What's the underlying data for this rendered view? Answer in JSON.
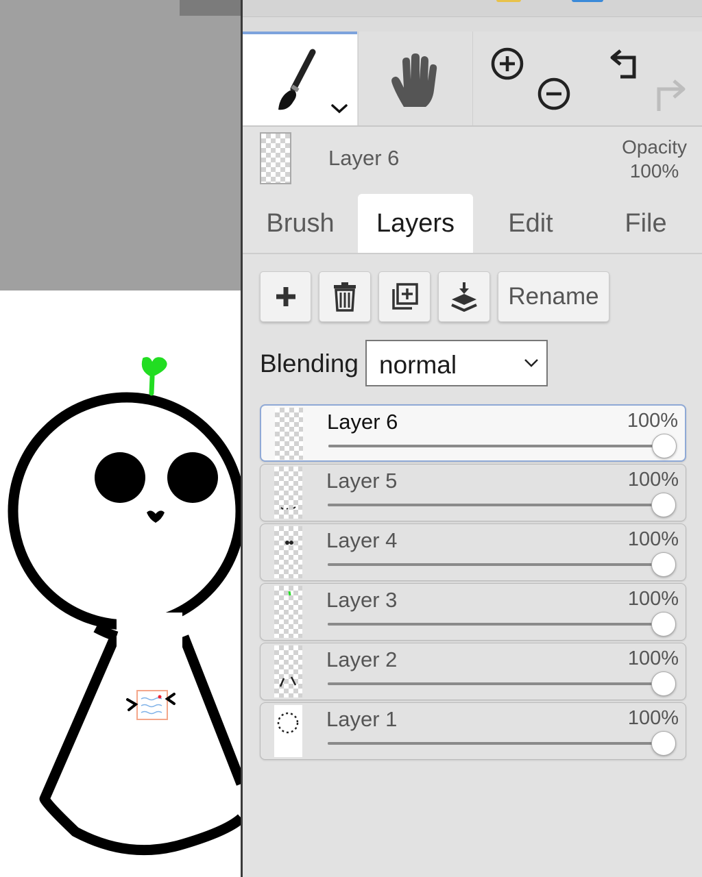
{
  "colors": {
    "accent": "#7da3dc",
    "panel_bg": "#dcdcdc",
    "sprout_green": "#22dd22"
  },
  "toolbar": {
    "brush_icon": "paintbrush-icon",
    "hand_icon": "hand-icon",
    "zoom_in_icon": "zoom-in-icon",
    "zoom_out_icon": "zoom-out-icon",
    "undo_icon": "undo-icon",
    "redo_icon": "redo-icon"
  },
  "current_layer": {
    "name": "Layer 6",
    "opacity_label": "Opacity",
    "opacity_value": "100%"
  },
  "tabs": [
    {
      "label": "Brush",
      "active": false
    },
    {
      "label": "Layers",
      "active": true
    },
    {
      "label": "Edit",
      "active": false
    },
    {
      "label": "File",
      "active": false
    }
  ],
  "layer_actions": {
    "add_icon": "plus-icon",
    "delete_icon": "trash-icon",
    "duplicate_icon": "duplicate-icon",
    "merge_down_icon": "merge-down-icon",
    "rename_label": "Rename"
  },
  "blending": {
    "label": "Blending",
    "value": "normal"
  },
  "layers": [
    {
      "name": "Layer 6",
      "opacity": "100%",
      "opacity_level": 1.0,
      "selected": true
    },
    {
      "name": "Layer 5",
      "opacity": "100%",
      "opacity_level": 1.0,
      "selected": false
    },
    {
      "name": "Layer 4",
      "opacity": "100%",
      "opacity_level": 1.0,
      "selected": false
    },
    {
      "name": "Layer 3",
      "opacity": "100%",
      "opacity_level": 1.0,
      "selected": false
    },
    {
      "name": "Layer 2",
      "opacity": "100%",
      "opacity_level": 1.0,
      "selected": false
    },
    {
      "name": "Layer 1",
      "opacity": "100%",
      "opacity_level": 1.0,
      "selected": false
    }
  ]
}
